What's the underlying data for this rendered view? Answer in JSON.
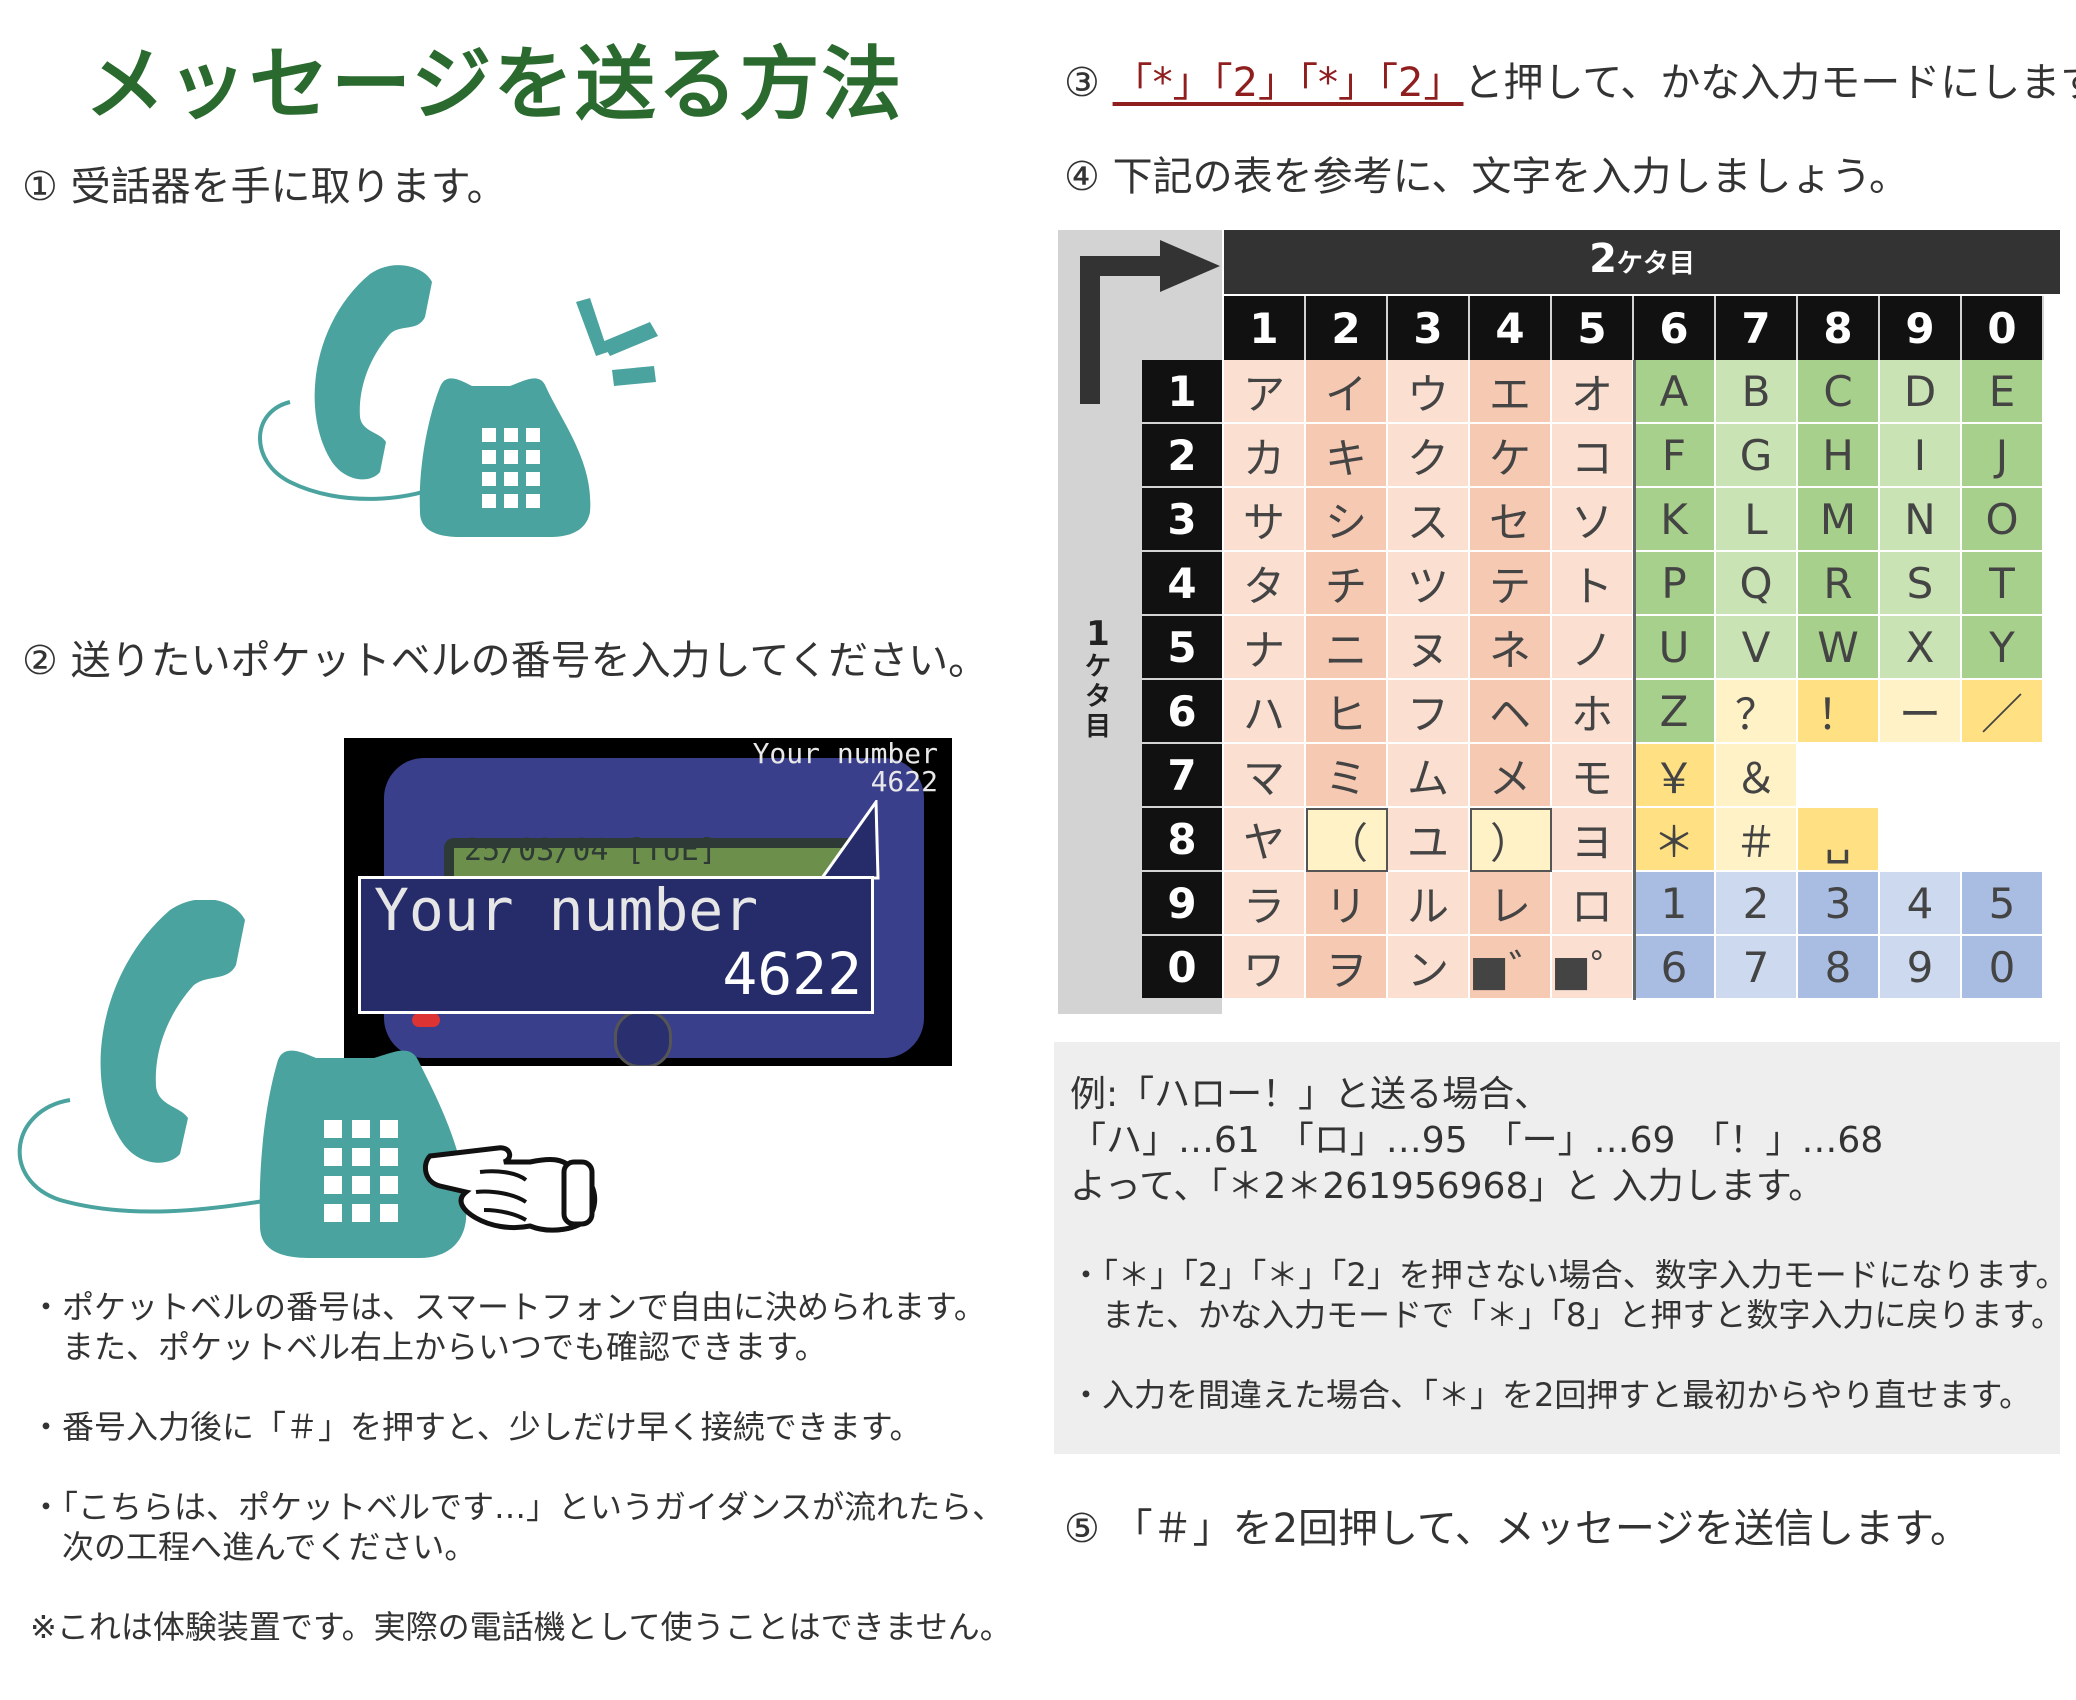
{
  "title": "メッセージを送る方法",
  "steps": {
    "s1": "① 受話器を手に取ります。",
    "s2": "② 送りたいポケットベルの番号を入力してください。",
    "s3_prefix": "③",
    "s3_keys": "「*」「2」「*」「2」",
    "s3_suffix": "と押して、かな入力モードにします。",
    "s4": "④ 下記の表を参考に、文字を入力しましょう。",
    "s5": "⑤ 「＃」を2回押して、メッセージを送信します。"
  },
  "pager": {
    "corner_label": "Your number",
    "corner_number": "4622",
    "lcd_text": "25/03/04 [TUE]",
    "bubble_label": "Your number",
    "bubble_number": "4622"
  },
  "left_notes": {
    "n1a": "・ポケットベルの番号は、スマートフォンで自由に決められます。",
    "n1b": "　また、ポケットベル右上からいつでも確認できます。",
    "n2": "・番号入力後に「＃」を押すと、少しだけ早く接続できます。",
    "n3a": "・「こちらは、ポケットベルです…」というガイダンスが流れたら、",
    "n3b": "　次の工程へ進んでください。",
    "n4": "※これは体験装置です。実際の電話機として使うことはできません。"
  },
  "table": {
    "header_main": "2",
    "header_suffix": "ケタ目",
    "row_label_main": "1",
    "row_label_suffix": [
      "ケ",
      "タ",
      "目"
    ],
    "columns": [
      "1",
      "2",
      "3",
      "4",
      "5",
      "6",
      "7",
      "8",
      "9",
      "0"
    ],
    "rows": [
      {
        "key": "1",
        "cells": [
          "ア",
          "イ",
          "ウ",
          "エ",
          "オ",
          "A",
          "B",
          "C",
          "D",
          "E"
        ]
      },
      {
        "key": "2",
        "cells": [
          "カ",
          "キ",
          "ク",
          "ケ",
          "コ",
          "F",
          "G",
          "H",
          "I",
          "J"
        ]
      },
      {
        "key": "3",
        "cells": [
          "サ",
          "シ",
          "ス",
          "セ",
          "ソ",
          "K",
          "L",
          "M",
          "N",
          "O"
        ]
      },
      {
        "key": "4",
        "cells": [
          "タ",
          "チ",
          "ツ",
          "テ",
          "ト",
          "P",
          "Q",
          "R",
          "S",
          "T"
        ]
      },
      {
        "key": "5",
        "cells": [
          "ナ",
          "ニ",
          "ヌ",
          "ネ",
          "ノ",
          "U",
          "V",
          "W",
          "X",
          "Y"
        ]
      },
      {
        "key": "6",
        "cells": [
          "ハ",
          "ヒ",
          "フ",
          "ヘ",
          "ホ",
          "Z",
          "？",
          "！",
          "ー",
          "／"
        ]
      },
      {
        "key": "7",
        "cells": [
          "マ",
          "ミ",
          "ム",
          "メ",
          "モ",
          "￥",
          "＆",
          "",
          "",
          ""
        ]
      },
      {
        "key": "8",
        "cells": [
          "ヤ",
          "（",
          "ユ",
          "）",
          "ヨ",
          "＊",
          "＃",
          "␣",
          "",
          ""
        ]
      },
      {
        "key": "9",
        "cells": [
          "ラ",
          "リ",
          "ル",
          "レ",
          "ロ",
          "1",
          "2",
          "3",
          "4",
          "5"
        ]
      },
      {
        "key": "0",
        "cells": [
          "ワ",
          "ヲ",
          "ン",
          "■゛",
          "■゜",
          "6",
          "7",
          "8",
          "9",
          "0"
        ]
      }
    ],
    "colors": {
      "kana_a": "#f6c9b3",
      "kana_b": "#fbe0d2",
      "alpha_a": "#a8d08d",
      "alpha_b": "#c9e3b4",
      "symbol_a": "#ffe082",
      "symbol_b": "#fff2c6",
      "number_a": "#a9bde3",
      "number_b": "#cdd9ef",
      "header_dark": "#333333",
      "teal": "#4aa39e",
      "title_green": "#2b6a2f",
      "key_red": "#8f1f1f"
    }
  },
  "example": {
    "l1": "例:「ハロー！」と送る場合、",
    "l2": "「ハ」…61　「ロ」…95　「ー」…69　「！」…68",
    "l3": " よって、「＊2＊261956968」と 入力します。",
    "b1a": "・「＊」「2」「＊」「2」を押さない場合、数字入力モードになります。",
    "b1b": "　また、かな入力モードで「＊」「8」と押すと数字入力に戻ります。",
    "b2": "・入力を間違えた場合、「＊」を2回押すと最初からやり直せます。"
  }
}
